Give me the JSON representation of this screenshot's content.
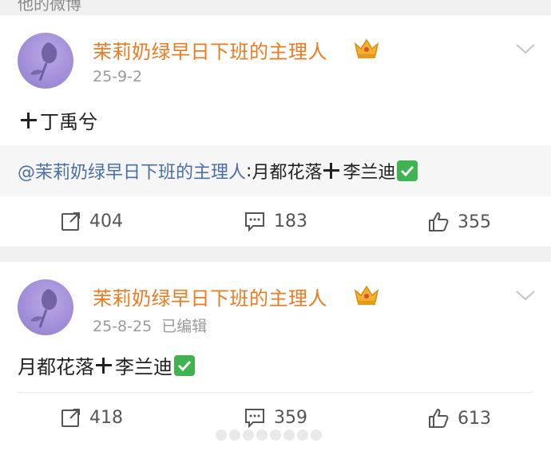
{
  "section_header": "他的微博",
  "posts": [
    {
      "user_name": "茉莉奶绿早日下班的主理人",
      "date": "25-9-2",
      "edited": "",
      "text_after_plus": "丁禹兮",
      "repost": {
        "mention": "@茉莉奶绿早日下班的主理人",
        "separator": " :",
        "before_plus": "月都花落",
        "after_plus": "李兰迪"
      },
      "actions": {
        "repost": "404",
        "comment": "183",
        "like": "355"
      }
    },
    {
      "user_name": "茉莉奶绿早日下班的主理人",
      "date": "25-8-25",
      "edited": "已编辑",
      "before_plus": "月都花落",
      "after_plus": "李兰迪",
      "actions": {
        "repost": "418",
        "comment": "359",
        "like": "613"
      }
    }
  ],
  "colors": {
    "username": "#ee7a20",
    "mention": "#4a6fa5",
    "check_badge": "#3eb34f",
    "background": "#f0f0f0"
  },
  "icons": {
    "verified": "crown-badge-icon",
    "more": "chevron-down-icon",
    "repost": "share-icon",
    "comment": "comment-icon",
    "like": "thumbs-up-icon",
    "check": "check-mark-icon"
  }
}
